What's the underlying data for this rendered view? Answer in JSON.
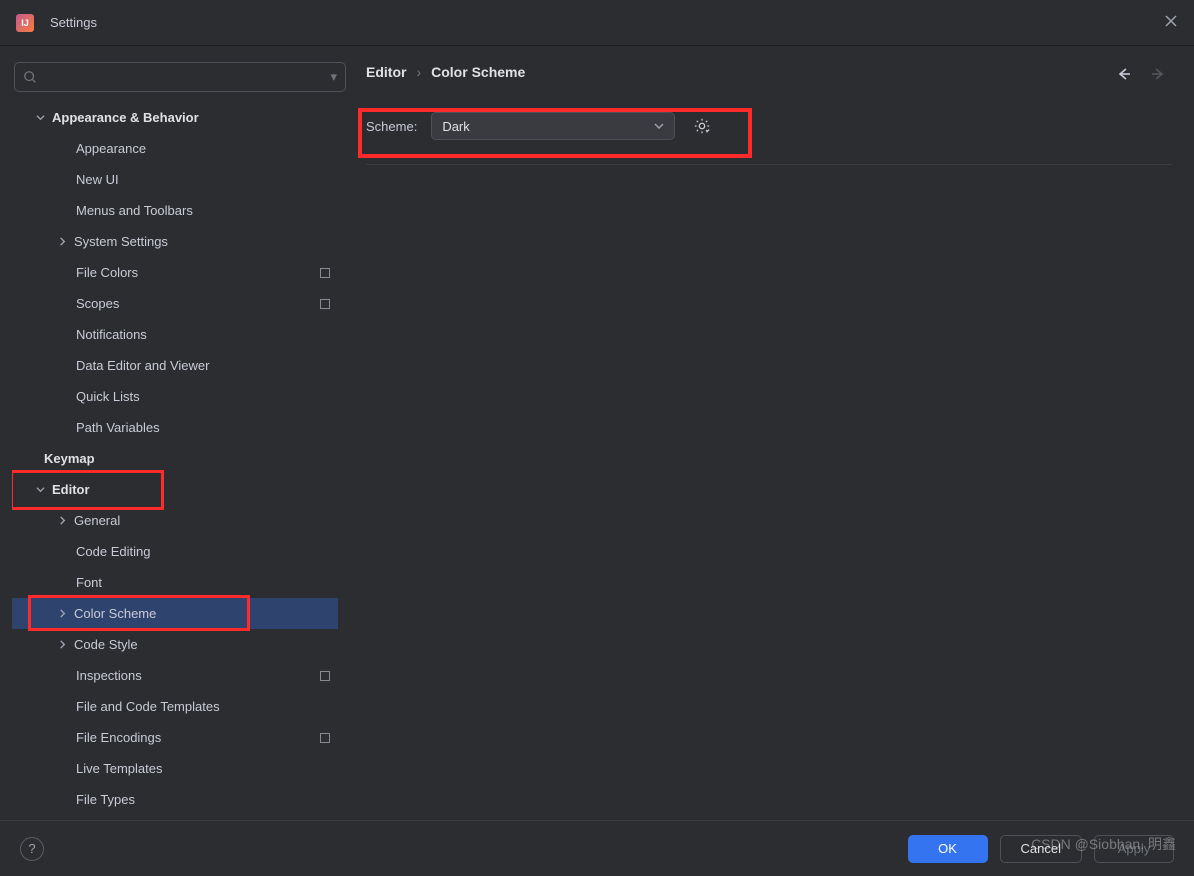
{
  "window": {
    "title": "Settings"
  },
  "search": {
    "placeholder": ""
  },
  "sidebar": {
    "items": [
      {
        "label": "Appearance & Behavior",
        "bold": true,
        "indent": 0,
        "chev": "down"
      },
      {
        "label": "Appearance",
        "indent": 2
      },
      {
        "label": "New UI",
        "indent": 2
      },
      {
        "label": "Menus and Toolbars",
        "indent": 2
      },
      {
        "label": "System Settings",
        "indent": 1,
        "chev": "right"
      },
      {
        "label": "File Colors",
        "indent": 2,
        "restart": true
      },
      {
        "label": "Scopes",
        "indent": 2,
        "restart": true
      },
      {
        "label": "Notifications",
        "indent": 2
      },
      {
        "label": "Data Editor and Viewer",
        "indent": 2
      },
      {
        "label": "Quick Lists",
        "indent": 2
      },
      {
        "label": "Path Variables",
        "indent": 2
      },
      {
        "label": "Keymap",
        "bold": true,
        "indent": 0,
        "nochev": true,
        "padLeft": 32
      },
      {
        "label": "Editor",
        "bold": true,
        "indent": 0,
        "chev": "down",
        "hl": "editor"
      },
      {
        "label": "General",
        "indent": 1,
        "chev": "right"
      },
      {
        "label": "Code Editing",
        "indent": 2
      },
      {
        "label": "Font",
        "indent": 2
      },
      {
        "label": "Color Scheme",
        "indent": 1,
        "chev": "right",
        "selected": true,
        "hl": "cs"
      },
      {
        "label": "Code Style",
        "indent": 1,
        "chev": "right"
      },
      {
        "label": "Inspections",
        "indent": 2,
        "restart": true
      },
      {
        "label": "File and Code Templates",
        "indent": 2
      },
      {
        "label": "File Encodings",
        "indent": 2,
        "restart": true
      },
      {
        "label": "Live Templates",
        "indent": 2
      },
      {
        "label": "File Types",
        "indent": 2
      }
    ]
  },
  "breadcrumb": {
    "a": "Editor",
    "sep": "›",
    "b": "Color Scheme"
  },
  "scheme": {
    "label": "Scheme:",
    "value": "Dark"
  },
  "footer": {
    "ok": "OK",
    "cancel": "Cancel",
    "apply": "Apply",
    "help": "?"
  },
  "watermark": "CSDN @Siobhan. 明鑫"
}
